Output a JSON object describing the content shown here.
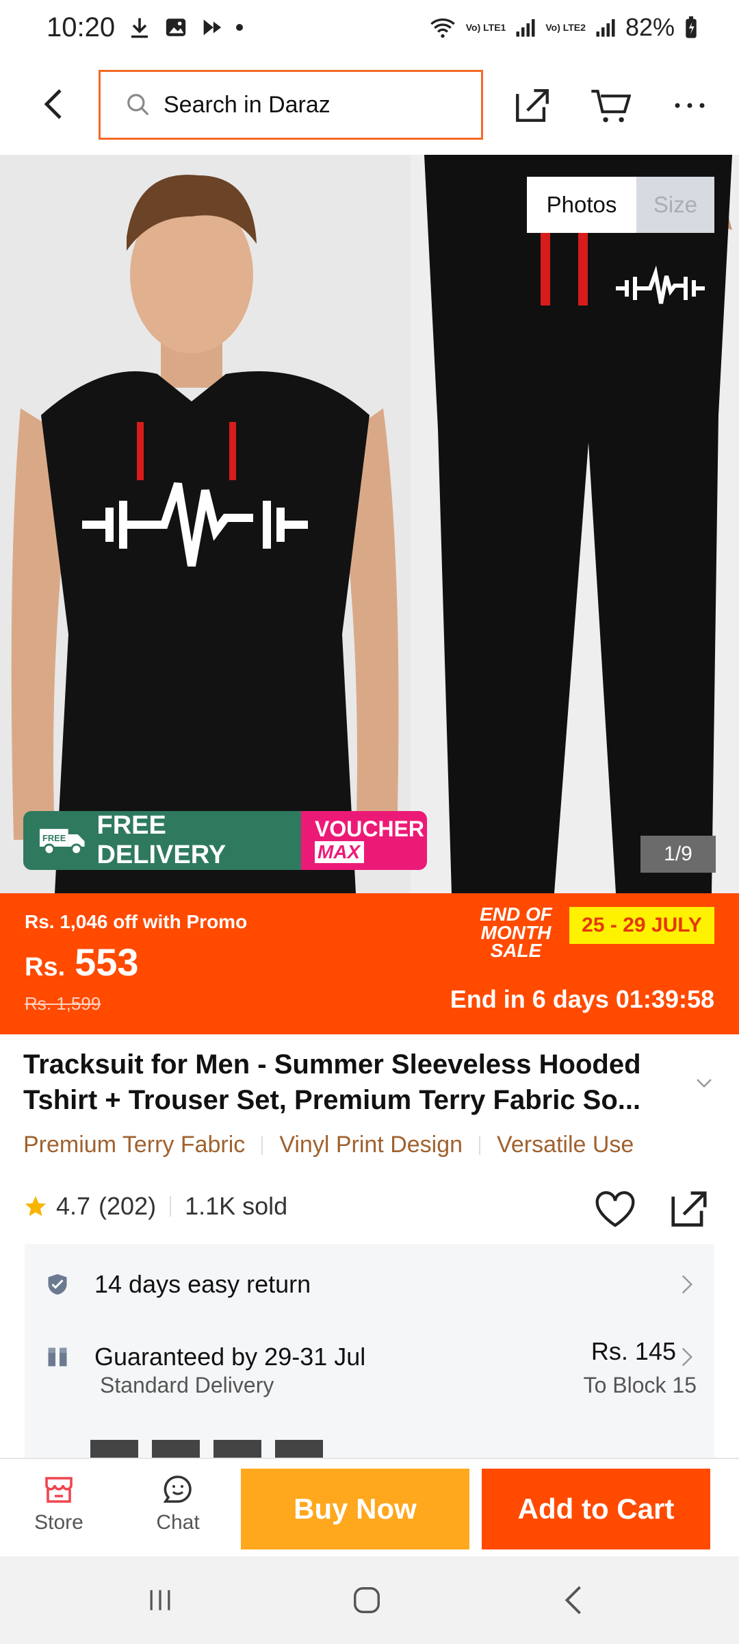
{
  "status_bar": {
    "time": "10:20",
    "sim1": "Vo) LTE1",
    "sim2": "Vo) LTE2",
    "battery": "82%"
  },
  "top_bar": {
    "search_placeholder": "Search in Daraz",
    "icons": [
      "back-icon",
      "share-icon",
      "cart-icon",
      "more-icon"
    ]
  },
  "gallery": {
    "tab_photos": "Photos",
    "tab_size": "Size",
    "counter": "1/9",
    "badge_free_small": "FREE",
    "badge_free_delivery": "FREE DELIVERY",
    "badge_voucher": "VOUCHER",
    "badge_max": "MAX"
  },
  "price": {
    "promo": "Rs. 1,046 off with Promo",
    "currency": "Rs.",
    "amount": "553",
    "original": "Rs. 1,599",
    "sale_label_1": "END OF",
    "sale_label_2": "MONTH SALE",
    "sale_dates": "25 - 29 JULY",
    "countdown": "End in 6 days 01:39:58",
    "colors": {
      "banner": "#ff4a00",
      "dates_bg": "#fff200"
    }
  },
  "product": {
    "title": "Tracksuit for Men - Summer Sleeveless Hooded Tshirt + Trouser Set, Premium Terry Fabric So...",
    "features": [
      "Premium Terry Fabric",
      "Vinyl Print Design",
      "Versatile Use"
    ],
    "rating": "4.7",
    "reviews": "(202)",
    "sold": "1.1K sold"
  },
  "services": {
    "return": "14 days easy return",
    "guarantee": "Guaranteed by 29-31 Jul",
    "delivery_type": "Standard Delivery",
    "delivery_fee": "Rs. 145",
    "delivery_to": "To Block 15"
  },
  "actions": {
    "store": "Store",
    "chat": "Chat",
    "buy_now": "Buy Now",
    "add_to_cart": "Add to Cart"
  }
}
